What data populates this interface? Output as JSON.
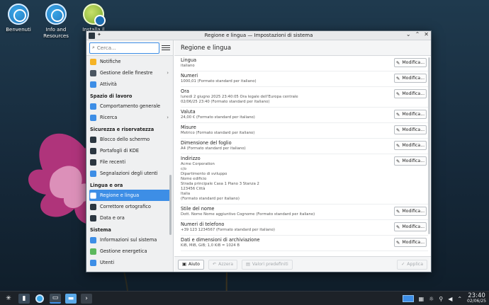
{
  "desktop": {
    "icons": [
      {
        "label": "Benvenuti"
      },
      {
        "label": "Info and Resources"
      },
      {
        "label": "Installa il"
      }
    ]
  },
  "window": {
    "title": "Regione e lingua — Impostazioni di sistema",
    "search_placeholder": "Cerca...",
    "page_title": "Regione e lingua"
  },
  "sidebar": {
    "items_top": [
      {
        "label": "Notifiche",
        "icon": "bell-icon",
        "color": "#f5b325"
      },
      {
        "label": "Gestione delle finestre",
        "icon": "windows-icon",
        "color": "#4a5560",
        "arrow": "›"
      },
      {
        "label": "Attività",
        "icon": "activities-icon",
        "color": "#3d8ee6"
      }
    ],
    "section_workspace": "Spazio di lavoro",
    "items_workspace": [
      {
        "label": "Comportamento generale",
        "icon": "general-behavior-icon",
        "color": "#3d8ee6"
      },
      {
        "label": "Ricerca",
        "icon": "search-icon",
        "color": "#3d8ee6",
        "arrow": "›"
      }
    ],
    "section_security": "Sicurezza e riservatezza",
    "items_security": [
      {
        "label": "Blocco dello schermo",
        "icon": "lock-screen-icon",
        "color": "#2b3640"
      },
      {
        "label": "Portafogli di KDE",
        "icon": "wallet-icon",
        "color": "#2b3640"
      },
      {
        "label": "File recenti",
        "icon": "recent-files-icon",
        "color": "#2b3640"
      },
      {
        "label": "Segnalazioni degli utenti",
        "icon": "feedback-icon",
        "color": "#3d8ee6"
      }
    ],
    "section_language": "Lingua e ora",
    "items_language": [
      {
        "label": "Regione e lingua",
        "icon": "region-icon",
        "color": "#ffffff",
        "active": true
      },
      {
        "label": "Correttore ortografico",
        "icon": "spellcheck-icon",
        "color": "#2b3640"
      },
      {
        "label": "Data e ora",
        "icon": "clock-icon",
        "color": "#2b3640"
      }
    ],
    "section_system": "Sistema",
    "items_system": [
      {
        "label": "Informazioni sul sistema",
        "icon": "info-icon",
        "color": "#3d8ee6"
      },
      {
        "label": "Gestione energetica",
        "icon": "energy-icon",
        "color": "#5cb85c"
      },
      {
        "label": "Utenti",
        "icon": "users-icon",
        "color": "#3d8ee6"
      }
    ]
  },
  "settings": [
    {
      "title": "Lingua",
      "sub": "italiano"
    },
    {
      "title": "Numeri",
      "sub": "1000,01 (Formato standard per italiano)"
    },
    {
      "title": "Ora",
      "sub": "lunedì 2 giugno 2025 23:40:05 Ora legale dell'Europa centrale\n02/06/25 23:40 (Formato standard per italiano)"
    },
    {
      "title": "Valuta",
      "sub": "24,00 € (Formato standard per italiano)"
    },
    {
      "title": "Misure",
      "sub": "Metrico (Formato standard per italiano)"
    },
    {
      "title": "Dimensione del foglio",
      "sub": "A4 (Formato standard per italiano)"
    },
    {
      "title": "Indirizzo",
      "sub": "Acme Corporation\nc/o\nDipartimento di sviluppo\nNome edificio\nStrada principale Casa 1 Piano 3 Stanza 2\n123456 Città\nItalia\n (Formato standard per italiano)"
    },
    {
      "title": "Stile del nome",
      "sub": "Dott. Nome Nome aggiuntivo Cognome (Formato standard per italiano)"
    },
    {
      "title": "Numeri di telefono",
      "sub": "+39 123 1234567 (Formato standard per italiano)"
    },
    {
      "title": "Dati e dimensioni di archiviazione",
      "sub": "KiB, MiB, GiB; 1,0 KiB = 1024 B"
    }
  ],
  "modify_label": "Modifica...",
  "footer": {
    "help": "Aiuto",
    "reset": "Azzera",
    "defaults": "Valori predefiniti",
    "apply": "Applica"
  },
  "taskbar": {
    "time": "23:40",
    "date": "02/06/25"
  }
}
